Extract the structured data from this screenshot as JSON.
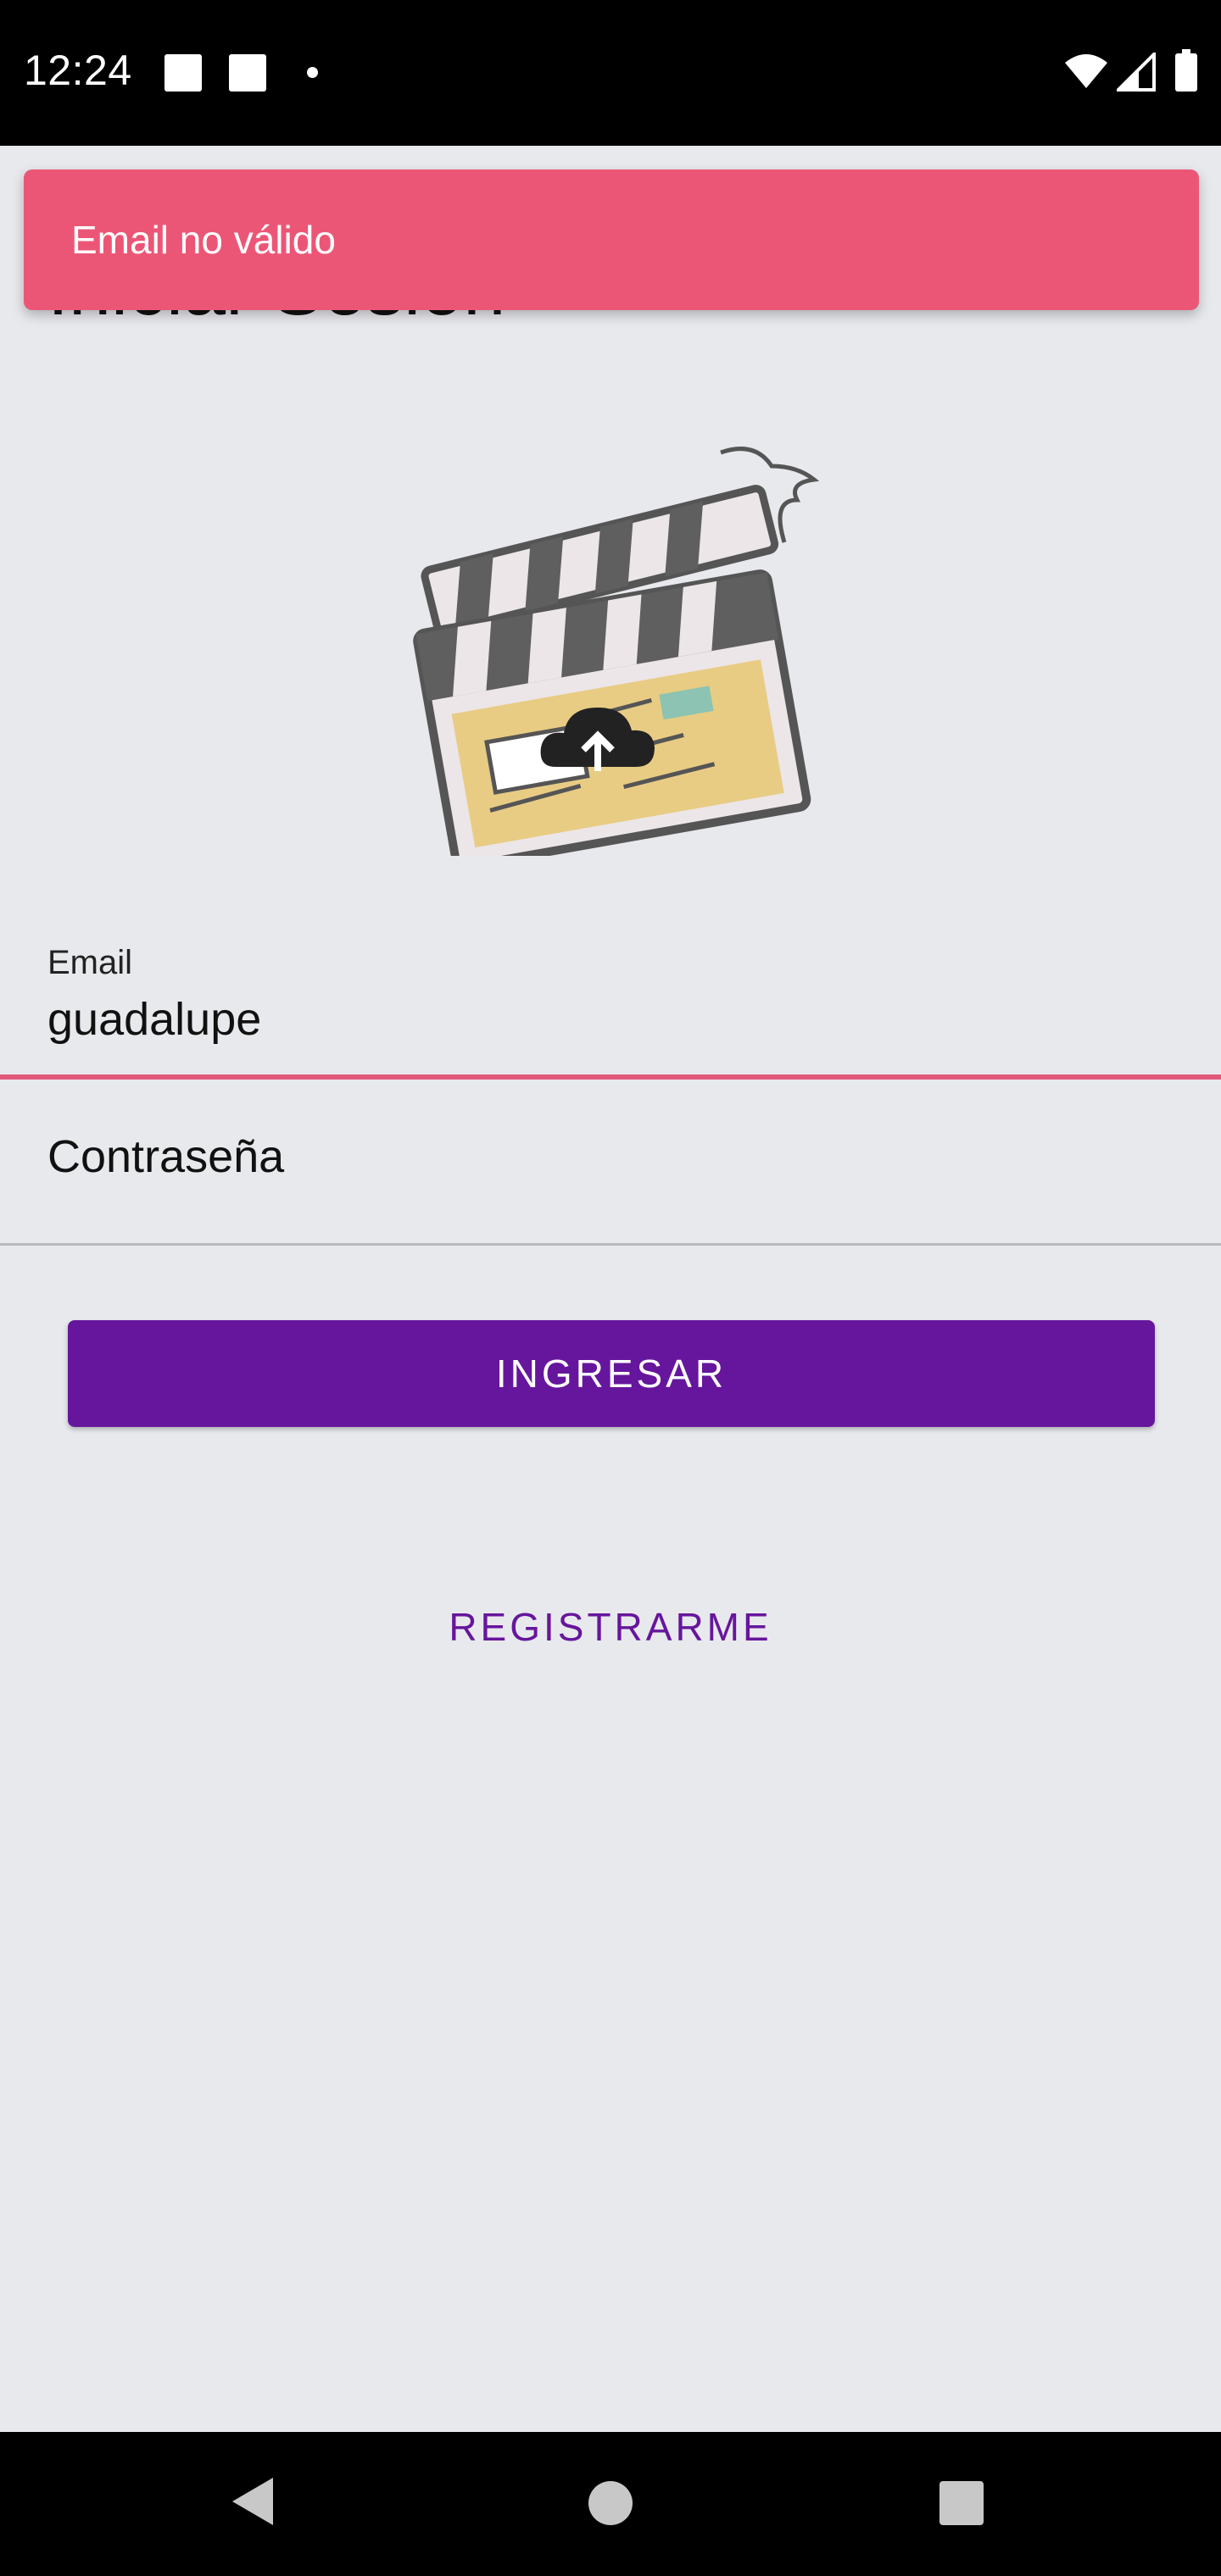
{
  "status_bar": {
    "time": "12:24"
  },
  "page": {
    "title": "Iniciar Sesión"
  },
  "snackbar": {
    "message": "Email no válido"
  },
  "form": {
    "email": {
      "label": "Email",
      "value": "guadalupe"
    },
    "password": {
      "placeholder": "Contraseña"
    }
  },
  "actions": {
    "login_label": "INGRESAR",
    "register_label": "REGISTRARME"
  },
  "colors": {
    "primary": "#66169c",
    "error": "#ec5676",
    "background": "#e8e9ed"
  },
  "icons": [
    "wifi-icon",
    "cell-signal-icon",
    "battery-icon",
    "clapperboard-upload-illustration",
    "back-icon",
    "home-icon",
    "recents-icon"
  ]
}
